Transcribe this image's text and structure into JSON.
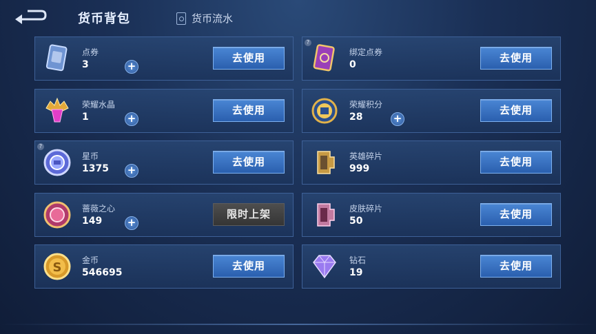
{
  "header": {
    "title": "货币背包",
    "flow_label": "货币流水"
  },
  "currencies": [
    {
      "name": "点券",
      "amount": "3",
      "action": "去使用"
    },
    {
      "name": "绑定点券",
      "amount": "0",
      "action": "去使用"
    },
    {
      "name": "荣耀水晶",
      "amount": "1",
      "action": "去使用"
    },
    {
      "name": "荣耀积分",
      "amount": "28",
      "action": "去使用"
    },
    {
      "name": "星币",
      "amount": "1375",
      "action": "去使用"
    },
    {
      "name": "英雄碎片",
      "amount": "999",
      "action": "去使用"
    },
    {
      "name": "蔷薇之心",
      "amount": "149",
      "action": "限时上架"
    },
    {
      "name": "皮肤碎片",
      "amount": "50",
      "action": "去使用"
    },
    {
      "name": "金币",
      "amount": "546695",
      "action": "去使用"
    },
    {
      "name": "钻石",
      "amount": "19",
      "action": "去使用"
    }
  ],
  "icons": [
    "back-arrow-icon",
    "ledger-icon",
    "coupon-card-icon",
    "bound-coupon-card-icon",
    "crystal-icon",
    "honor-points-icon",
    "star-coin-icon",
    "hero-shard-icon",
    "rose-heart-icon",
    "skin-shard-icon",
    "gold-coin-icon",
    "diamond-icon",
    "plus-icon",
    "help-icon"
  ],
  "colors": {
    "button_blue": "#3b74c4",
    "button_gray": "#3f3f3f",
    "card_border": "#3e6198"
  }
}
